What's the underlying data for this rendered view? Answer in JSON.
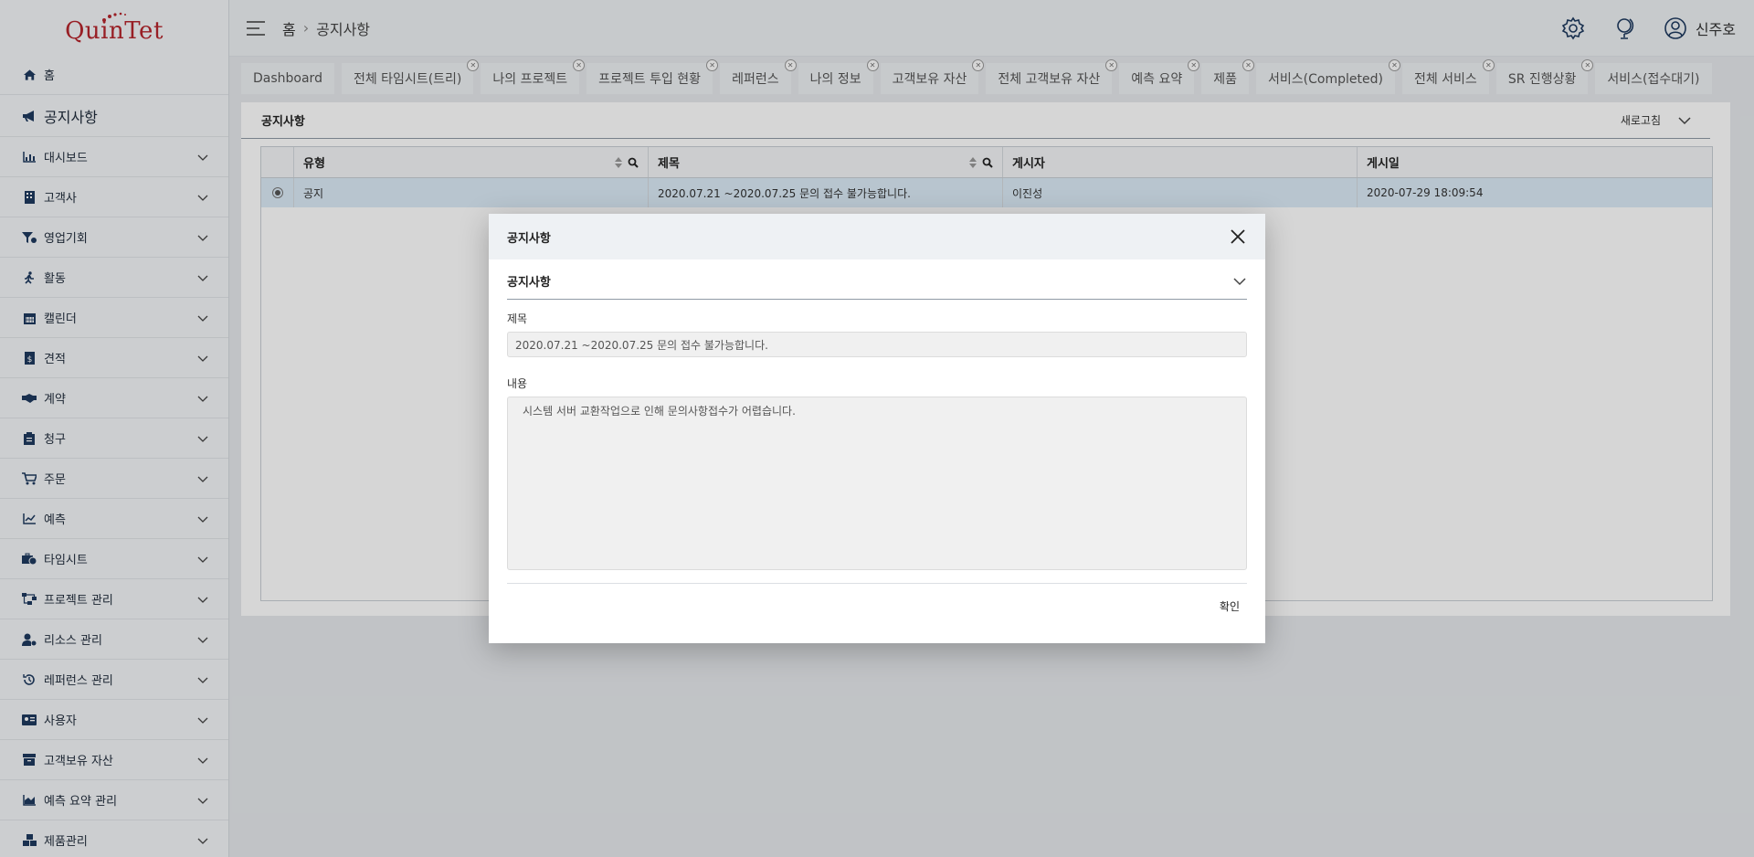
{
  "app": {
    "logo_text": "QuinTet"
  },
  "sidebar": {
    "items": [
      {
        "label": "홈",
        "icon": "home-icon"
      },
      {
        "label": "공지사항",
        "icon": "megaphone-icon"
      },
      {
        "label": "대시보드",
        "icon": "bar-chart-icon"
      },
      {
        "label": "고객사",
        "icon": "building-icon"
      },
      {
        "label": "영업기회",
        "icon": "funnel-icon"
      },
      {
        "label": "활동",
        "icon": "running-icon"
      },
      {
        "label": "캘린더",
        "icon": "calendar-icon"
      },
      {
        "label": "견적",
        "icon": "quote-doc-icon"
      },
      {
        "label": "계약",
        "icon": "handshake-icon"
      },
      {
        "label": "청구",
        "icon": "clipboard-icon"
      },
      {
        "label": "주문",
        "icon": "cart-icon"
      },
      {
        "label": "예측",
        "icon": "line-chart-icon"
      },
      {
        "label": "타임시트",
        "icon": "briefcase-clock-icon"
      },
      {
        "label": "프로젝트 관리",
        "icon": "project-tree-icon"
      },
      {
        "label": "리소스 관리",
        "icon": "user-gear-icon"
      },
      {
        "label": "레퍼런스 관리",
        "icon": "history-icon"
      },
      {
        "label": "사용자",
        "icon": "id-card-icon"
      },
      {
        "label": "고객보유 자산",
        "icon": "archive-icon"
      },
      {
        "label": "예측 요약 관리",
        "icon": "area-chart-icon"
      },
      {
        "label": "제품관리",
        "icon": "boxes-icon"
      }
    ]
  },
  "header": {
    "breadcrumb": [
      "홈",
      "공지사항"
    ],
    "user_name": "신주호"
  },
  "tabs": [
    "Dashboard",
    "전체 타임시트(트리)",
    "나의 프로젝트",
    "프로젝트 투입 현황",
    "레퍼런스",
    "나의 정보",
    "고객보유 자산",
    "전체 고객보유 자산",
    "예측 요약",
    "제품",
    "서비스(Completed)",
    "전체 서비스",
    "SR 진행상황",
    "서비스(접수대기)"
  ],
  "panel": {
    "title": "공지사항",
    "refresh_label": "새로고침",
    "columns": [
      "유형",
      "제목",
      "게시자",
      "게시일"
    ],
    "rows": [
      {
        "type": "공지",
        "title": "2020.07.21 ~2020.07.25 문의 접수 불가능합니다.",
        "author": "이진성",
        "date": "2020-07-29 18:09:54"
      }
    ]
  },
  "modal": {
    "title": "공지사항",
    "section_title": "공지사항",
    "subject_label": "제목",
    "subject_value": "2020.07.21 ~2020.07.25 문의 접수 불가능합니다.",
    "content_label": "내용",
    "content_value": "시스템 서버 교환작업으로 인해 문의사항접수가 어렵습니다.",
    "ok_label": "확인"
  },
  "colors": {
    "brand_red": "#b5262d",
    "selected_row": "#dcebf7",
    "navy_icon": "#1e3a5f"
  }
}
